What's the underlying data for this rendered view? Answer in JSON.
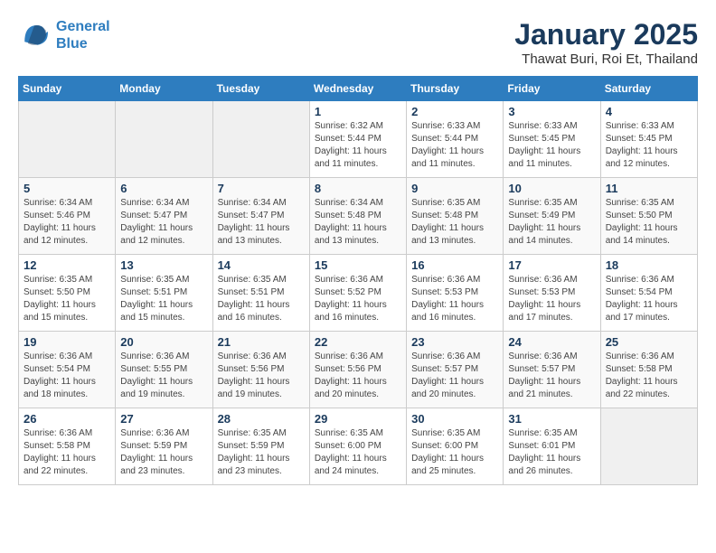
{
  "logo": {
    "line1": "General",
    "line2": "Blue"
  },
  "title": "January 2025",
  "subtitle": "Thawat Buri, Roi Et, Thailand",
  "header": {
    "days": [
      "Sunday",
      "Monday",
      "Tuesday",
      "Wednesday",
      "Thursday",
      "Friday",
      "Saturday"
    ]
  },
  "weeks": [
    [
      {
        "day": "",
        "sunrise": "",
        "sunset": "",
        "daylight": ""
      },
      {
        "day": "",
        "sunrise": "",
        "sunset": "",
        "daylight": ""
      },
      {
        "day": "",
        "sunrise": "",
        "sunset": "",
        "daylight": ""
      },
      {
        "day": "1",
        "sunrise": "Sunrise: 6:32 AM",
        "sunset": "Sunset: 5:44 PM",
        "daylight": "Daylight: 11 hours and 11 minutes."
      },
      {
        "day": "2",
        "sunrise": "Sunrise: 6:33 AM",
        "sunset": "Sunset: 5:44 PM",
        "daylight": "Daylight: 11 hours and 11 minutes."
      },
      {
        "day": "3",
        "sunrise": "Sunrise: 6:33 AM",
        "sunset": "Sunset: 5:45 PM",
        "daylight": "Daylight: 11 hours and 11 minutes."
      },
      {
        "day": "4",
        "sunrise": "Sunrise: 6:33 AM",
        "sunset": "Sunset: 5:45 PM",
        "daylight": "Daylight: 11 hours and 12 minutes."
      }
    ],
    [
      {
        "day": "5",
        "sunrise": "Sunrise: 6:34 AM",
        "sunset": "Sunset: 5:46 PM",
        "daylight": "Daylight: 11 hours and 12 minutes."
      },
      {
        "day": "6",
        "sunrise": "Sunrise: 6:34 AM",
        "sunset": "Sunset: 5:47 PM",
        "daylight": "Daylight: 11 hours and 12 minutes."
      },
      {
        "day": "7",
        "sunrise": "Sunrise: 6:34 AM",
        "sunset": "Sunset: 5:47 PM",
        "daylight": "Daylight: 11 hours and 13 minutes."
      },
      {
        "day": "8",
        "sunrise": "Sunrise: 6:34 AM",
        "sunset": "Sunset: 5:48 PM",
        "daylight": "Daylight: 11 hours and 13 minutes."
      },
      {
        "day": "9",
        "sunrise": "Sunrise: 6:35 AM",
        "sunset": "Sunset: 5:48 PM",
        "daylight": "Daylight: 11 hours and 13 minutes."
      },
      {
        "day": "10",
        "sunrise": "Sunrise: 6:35 AM",
        "sunset": "Sunset: 5:49 PM",
        "daylight": "Daylight: 11 hours and 14 minutes."
      },
      {
        "day": "11",
        "sunrise": "Sunrise: 6:35 AM",
        "sunset": "Sunset: 5:50 PM",
        "daylight": "Daylight: 11 hours and 14 minutes."
      }
    ],
    [
      {
        "day": "12",
        "sunrise": "Sunrise: 6:35 AM",
        "sunset": "Sunset: 5:50 PM",
        "daylight": "Daylight: 11 hours and 15 minutes."
      },
      {
        "day": "13",
        "sunrise": "Sunrise: 6:35 AM",
        "sunset": "Sunset: 5:51 PM",
        "daylight": "Daylight: 11 hours and 15 minutes."
      },
      {
        "day": "14",
        "sunrise": "Sunrise: 6:35 AM",
        "sunset": "Sunset: 5:51 PM",
        "daylight": "Daylight: 11 hours and 16 minutes."
      },
      {
        "day": "15",
        "sunrise": "Sunrise: 6:36 AM",
        "sunset": "Sunset: 5:52 PM",
        "daylight": "Daylight: 11 hours and 16 minutes."
      },
      {
        "day": "16",
        "sunrise": "Sunrise: 6:36 AM",
        "sunset": "Sunset: 5:53 PM",
        "daylight": "Daylight: 11 hours and 16 minutes."
      },
      {
        "day": "17",
        "sunrise": "Sunrise: 6:36 AM",
        "sunset": "Sunset: 5:53 PM",
        "daylight": "Daylight: 11 hours and 17 minutes."
      },
      {
        "day": "18",
        "sunrise": "Sunrise: 6:36 AM",
        "sunset": "Sunset: 5:54 PM",
        "daylight": "Daylight: 11 hours and 17 minutes."
      }
    ],
    [
      {
        "day": "19",
        "sunrise": "Sunrise: 6:36 AM",
        "sunset": "Sunset: 5:54 PM",
        "daylight": "Daylight: 11 hours and 18 minutes."
      },
      {
        "day": "20",
        "sunrise": "Sunrise: 6:36 AM",
        "sunset": "Sunset: 5:55 PM",
        "daylight": "Daylight: 11 hours and 19 minutes."
      },
      {
        "day": "21",
        "sunrise": "Sunrise: 6:36 AM",
        "sunset": "Sunset: 5:56 PM",
        "daylight": "Daylight: 11 hours and 19 minutes."
      },
      {
        "day": "22",
        "sunrise": "Sunrise: 6:36 AM",
        "sunset": "Sunset: 5:56 PM",
        "daylight": "Daylight: 11 hours and 20 minutes."
      },
      {
        "day": "23",
        "sunrise": "Sunrise: 6:36 AM",
        "sunset": "Sunset: 5:57 PM",
        "daylight": "Daylight: 11 hours and 20 minutes."
      },
      {
        "day": "24",
        "sunrise": "Sunrise: 6:36 AM",
        "sunset": "Sunset: 5:57 PM",
        "daylight": "Daylight: 11 hours and 21 minutes."
      },
      {
        "day": "25",
        "sunrise": "Sunrise: 6:36 AM",
        "sunset": "Sunset: 5:58 PM",
        "daylight": "Daylight: 11 hours and 22 minutes."
      }
    ],
    [
      {
        "day": "26",
        "sunrise": "Sunrise: 6:36 AM",
        "sunset": "Sunset: 5:58 PM",
        "daylight": "Daylight: 11 hours and 22 minutes."
      },
      {
        "day": "27",
        "sunrise": "Sunrise: 6:36 AM",
        "sunset": "Sunset: 5:59 PM",
        "daylight": "Daylight: 11 hours and 23 minutes."
      },
      {
        "day": "28",
        "sunrise": "Sunrise: 6:35 AM",
        "sunset": "Sunset: 5:59 PM",
        "daylight": "Daylight: 11 hours and 23 minutes."
      },
      {
        "day": "29",
        "sunrise": "Sunrise: 6:35 AM",
        "sunset": "Sunset: 6:00 PM",
        "daylight": "Daylight: 11 hours and 24 minutes."
      },
      {
        "day": "30",
        "sunrise": "Sunrise: 6:35 AM",
        "sunset": "Sunset: 6:00 PM",
        "daylight": "Daylight: 11 hours and 25 minutes."
      },
      {
        "day": "31",
        "sunrise": "Sunrise: 6:35 AM",
        "sunset": "Sunset: 6:01 PM",
        "daylight": "Daylight: 11 hours and 26 minutes."
      },
      {
        "day": "",
        "sunrise": "",
        "sunset": "",
        "daylight": ""
      }
    ]
  ]
}
